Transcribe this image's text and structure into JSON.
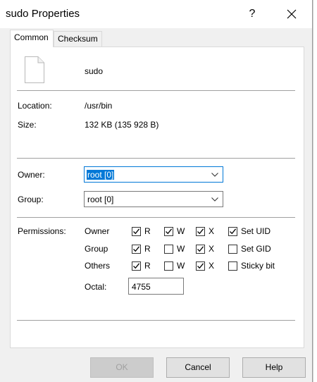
{
  "window": {
    "title": "sudo Properties",
    "help_glyph": "?",
    "close_icon": "close-icon"
  },
  "tabs": [
    {
      "label": "Common",
      "active": true
    },
    {
      "label": "Checksum",
      "active": false
    }
  ],
  "file": {
    "icon": "file-icon",
    "name": "sudo",
    "location_label": "Location:",
    "location_value": "/usr/bin",
    "size_label": "Size:",
    "size_value": "132 KB (135 928 B)"
  },
  "ownership": {
    "owner_label": "Owner:",
    "owner_value": "root [0]",
    "group_label": "Group:",
    "group_value": "root [0]"
  },
  "permissions": {
    "label": "Permissions:",
    "rows": [
      {
        "name": "Owner",
        "r": true,
        "w": true,
        "x": true,
        "special_label": "Set UID",
        "special": true
      },
      {
        "name": "Group",
        "r": true,
        "w": false,
        "x": true,
        "special_label": "Set GID",
        "special": false
      },
      {
        "name": "Others",
        "r": true,
        "w": false,
        "x": true,
        "special_label": "Sticky bit",
        "special": false
      }
    ],
    "r_label": "R",
    "w_label": "W",
    "x_label": "X",
    "octal_label": "Octal:",
    "octal_value": "4755"
  },
  "buttons": {
    "ok": "OK",
    "cancel": "Cancel",
    "help": "Help"
  },
  "colors": {
    "accent": "#0078d7",
    "dialog_bg": "#f0f0f0",
    "panel_bg": "#ffffff"
  }
}
